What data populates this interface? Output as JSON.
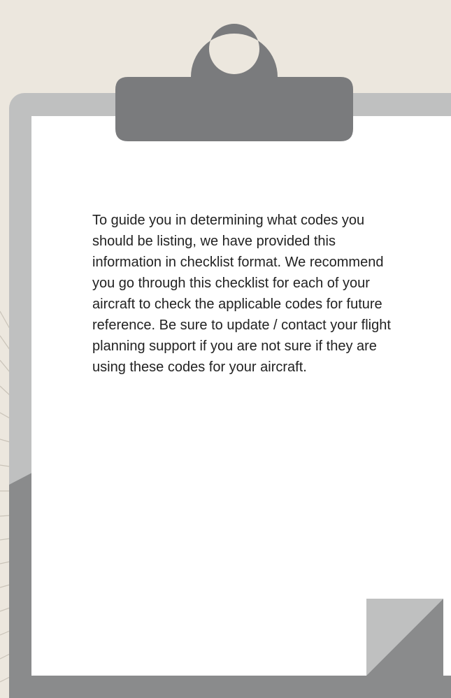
{
  "paper": {
    "text": "To guide you in determining what codes you should be listing, we have provided this information in checklist format. We recommend you go through this checklist for each of your aircraft to check the applicable codes for future reference. Be sure to update / contact your flight planning support if you are not sure if they are using these codes for your aircraft."
  },
  "colors": {
    "background": "#ece7de",
    "board_light": "#bfc0c0",
    "board_dark": "#8a8b8c",
    "clip": "#7a7b7d",
    "paper": "#ffffff",
    "text": "#222222"
  },
  "icons": {
    "clip": "clipboard-clip-icon",
    "curl": "page-curl-icon"
  }
}
